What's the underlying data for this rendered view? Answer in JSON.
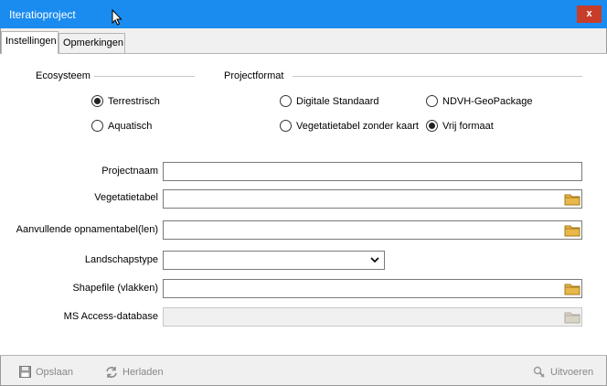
{
  "window": {
    "title": "Iteratioproject",
    "close_label": "x"
  },
  "tabs": [
    {
      "label": "Instellingen",
      "active": true
    },
    {
      "label": "Opmerkingen",
      "active": false
    }
  ],
  "ecosysteem": {
    "label": "Ecosysteem",
    "options": [
      {
        "label": "Terrestrisch",
        "checked": true
      },
      {
        "label": "Aquatisch",
        "checked": false
      }
    ]
  },
  "projectformat": {
    "label": "Projectformat",
    "options": [
      {
        "label": "Digitale Standaard",
        "checked": false
      },
      {
        "label": "NDVH-GeoPackage",
        "checked": false
      },
      {
        "label": "Vegetatietabel zonder kaart",
        "checked": false
      },
      {
        "label": "Vrij formaat",
        "checked": true
      }
    ]
  },
  "fields": {
    "projectnaam": {
      "label": "Projectnaam",
      "value": ""
    },
    "vegetatietabel": {
      "label": "Vegetatietabel",
      "value": ""
    },
    "aanvullende": {
      "label": "Aanvullende opnamentabel(len)",
      "value": ""
    },
    "landschapstype": {
      "label": "Landschapstype",
      "value": ""
    },
    "shapefile": {
      "label": "Shapefile (vlakken)",
      "value": ""
    },
    "msaccess": {
      "label": "MS Access-database",
      "value": ""
    }
  },
  "footer": {
    "save_label": "Opslaan",
    "reload_label": "Herladen",
    "run_label": "Uitvoeren"
  },
  "colors": {
    "titlebar": "#1a8cf0",
    "close": "#c83c2a",
    "folder": "#e8b84a"
  }
}
